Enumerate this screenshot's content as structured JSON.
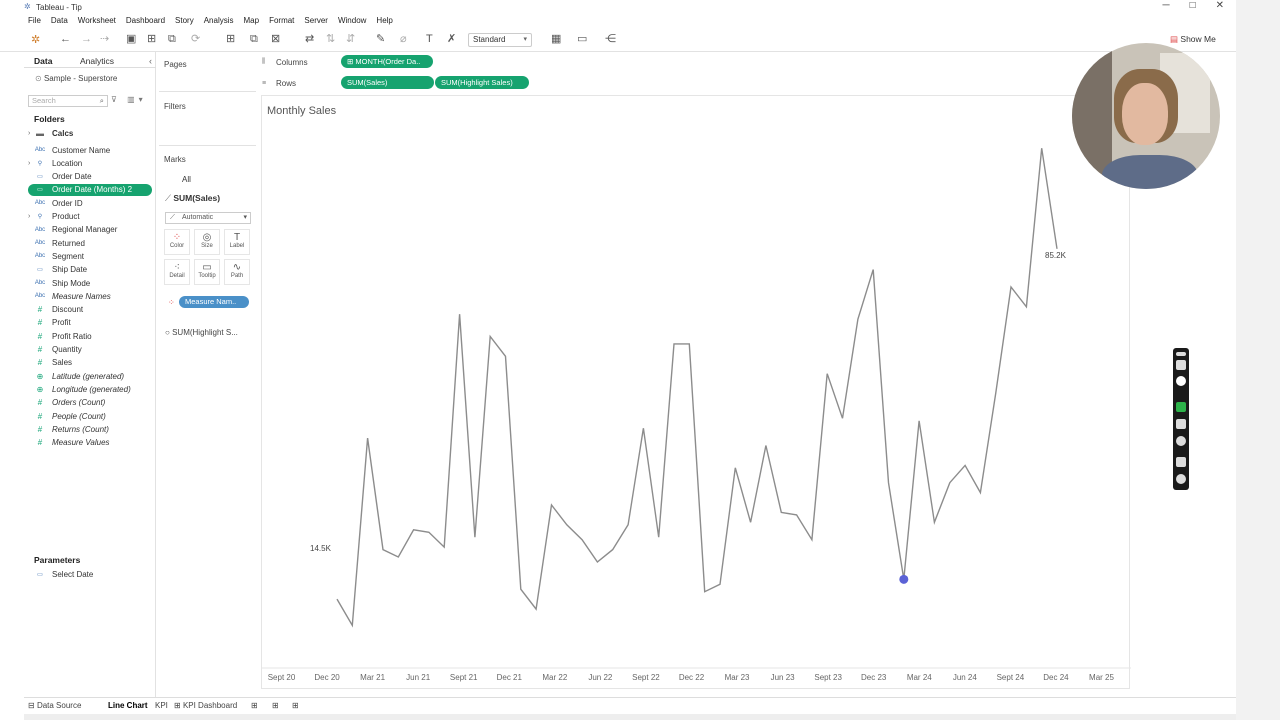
{
  "window": {
    "title": "Tableau - Tip",
    "minimize": "─",
    "maximize": "□",
    "close": "✕"
  },
  "menu": [
    "File",
    "Data",
    "Worksheet",
    "Dashboard",
    "Story",
    "Analysis",
    "Map",
    "Format",
    "Server",
    "Window",
    "Help"
  ],
  "toolbar": {
    "fit_select": "Standard",
    "show_me": "Show Me"
  },
  "left_panel": {
    "tabs": [
      "Data",
      "Analytics"
    ],
    "datasource": "Sample - Superstore",
    "search_placeholder": "Search",
    "folders_header": "Folders",
    "folder_calcs": "Calcs",
    "fields": [
      {
        "name": "Customer Name",
        "kind": "Abc",
        "measure": false,
        "italic": false
      },
      {
        "name": "Location",
        "kind": "geo",
        "measure": false,
        "italic": false,
        "expand": true
      },
      {
        "name": "Order Date",
        "kind": "date",
        "measure": false,
        "italic": false
      },
      {
        "name": "Order Date (Months) 2",
        "kind": "date",
        "measure": false,
        "italic": false,
        "selected": true
      },
      {
        "name": "Order ID",
        "kind": "Abc",
        "measure": false,
        "italic": false
      },
      {
        "name": "Product",
        "kind": "hier",
        "measure": false,
        "italic": false,
        "expand": true
      },
      {
        "name": "Regional Manager",
        "kind": "Abc",
        "measure": false,
        "italic": false
      },
      {
        "name": "Returned",
        "kind": "Abc",
        "measure": false,
        "italic": false
      },
      {
        "name": "Segment",
        "kind": "Abc",
        "measure": false,
        "italic": false
      },
      {
        "name": "Ship Date",
        "kind": "date",
        "measure": false,
        "italic": false
      },
      {
        "name": "Ship Mode",
        "kind": "Abc",
        "measure": false,
        "italic": false
      },
      {
        "name": "Measure Names",
        "kind": "Abc",
        "measure": false,
        "italic": true
      },
      {
        "name": "Discount",
        "kind": "#",
        "measure": true,
        "italic": false
      },
      {
        "name": "Profit",
        "kind": "#",
        "measure": true,
        "italic": false
      },
      {
        "name": "Profit Ratio",
        "kind": "#",
        "measure": true,
        "italic": false
      },
      {
        "name": "Quantity",
        "kind": "#",
        "measure": true,
        "italic": false
      },
      {
        "name": "Sales",
        "kind": "#",
        "measure": true,
        "italic": false
      },
      {
        "name": "Latitude (generated)",
        "kind": "globe",
        "measure": true,
        "italic": true
      },
      {
        "name": "Longitude (generated)",
        "kind": "globe",
        "measure": true,
        "italic": true
      },
      {
        "name": "Orders (Count)",
        "kind": "#",
        "measure": true,
        "italic": true
      },
      {
        "name": "People (Count)",
        "kind": "#",
        "measure": true,
        "italic": true
      },
      {
        "name": "Returns (Count)",
        "kind": "#",
        "measure": true,
        "italic": true
      },
      {
        "name": "Measure Values",
        "kind": "#",
        "measure": true,
        "italic": true
      }
    ],
    "parameters_header": "Parameters",
    "parameters": [
      "Select Date"
    ]
  },
  "cards": {
    "pages": "Pages",
    "filters": "Filters",
    "marks": "Marks",
    "marks_all": "All",
    "marks_sum": "SUM(Sales)",
    "mark_type": "Automatic",
    "buttons": [
      "Color",
      "Size",
      "Label",
      "Detail",
      "Tooltip",
      "Path"
    ],
    "measure_pill": "Measure Nam..",
    "highlight_item": "SUM(Highlight S..."
  },
  "shelves": {
    "columns_label": "Columns",
    "rows_label": "Rows",
    "columns_pill": "MONTH(Order Da..",
    "rows_pills": [
      "SUM(Sales)",
      "SUM(Highlight Sales)"
    ]
  },
  "sheet_tabs": {
    "data_source": "Data Source",
    "sheets": [
      "Line Chart",
      "KPI",
      "KPI Dashboard"
    ],
    "active": "Line Chart"
  },
  "chart_data": {
    "type": "line",
    "title": "Monthly Sales",
    "x_tick_labels": [
      "Sept 20",
      "Dec 20",
      "Mar 21",
      "Jun 21",
      "Sept 21",
      "Dec 21",
      "Mar 22",
      "Jun 22",
      "Sept 22",
      "Dec 22",
      "Mar 23",
      "Jun 23",
      "Sept 23",
      "Dec 23",
      "Mar 24",
      "Jun 24",
      "Sept 24",
      "Dec 24",
      "Mar 25"
    ],
    "x": [
      "Nov 20",
      "Dec 20",
      "Jan 21",
      "Feb 21",
      "Mar 21",
      "Apr 21",
      "May 21",
      "Jun 21",
      "Jul 21",
      "Aug 21",
      "Sep 21",
      "Oct 21",
      "Nov 21",
      "Dec 21",
      "Jan 22",
      "Feb 22",
      "Mar 22",
      "Apr 22",
      "May 22",
      "Jun 22",
      "Jul 22",
      "Aug 22",
      "Sep 22",
      "Oct 22",
      "Nov 22",
      "Dec 22",
      "Jan 23",
      "Feb 23",
      "Mar 23",
      "Apr 23",
      "May 23",
      "Jun 23",
      "Jul 23",
      "Aug 23",
      "Sep 23",
      "Oct 23",
      "Nov 23",
      "Dec 23",
      "Jan 24",
      "Feb 24",
      "Mar 24",
      "Apr 24",
      "May 24",
      "Jun 24",
      "Jul 24",
      "Aug 24",
      "Sep 24",
      "Oct 24",
      "Nov 24",
      "Dec 24"
    ],
    "series": [
      {
        "values": [
          14.5,
          9.2,
          47.0,
          24.5,
          23.0,
          28.5,
          28.0,
          25.0,
          72.0,
          27.0,
          67.5,
          63.5,
          16.5,
          12.5,
          33.5,
          29.5,
          26.5,
          22.0,
          24.5,
          29.5,
          49.0,
          27.0,
          66.0,
          66.0,
          16.0,
          17.5,
          41.0,
          30.0,
          45.5,
          32.0,
          31.5,
          26.5,
          60.0,
          51.0,
          71.0,
          81.0,
          38.0,
          18.5,
          50.5,
          30.0,
          38.0,
          41.5,
          36.0,
          56.0,
          77.5,
          73.5,
          105.5,
          85.2
        ]
      }
    ],
    "point_count_note": "",
    "labels": [
      {
        "text": "14.5K",
        "index": 0
      },
      {
        "text": "85.2K",
        "index": 47
      }
    ],
    "highlight": {
      "index": 37,
      "color": "#5b62d6"
    },
    "line_color": "#8c8c8c",
    "ylim": [
      0,
      112
    ]
  }
}
